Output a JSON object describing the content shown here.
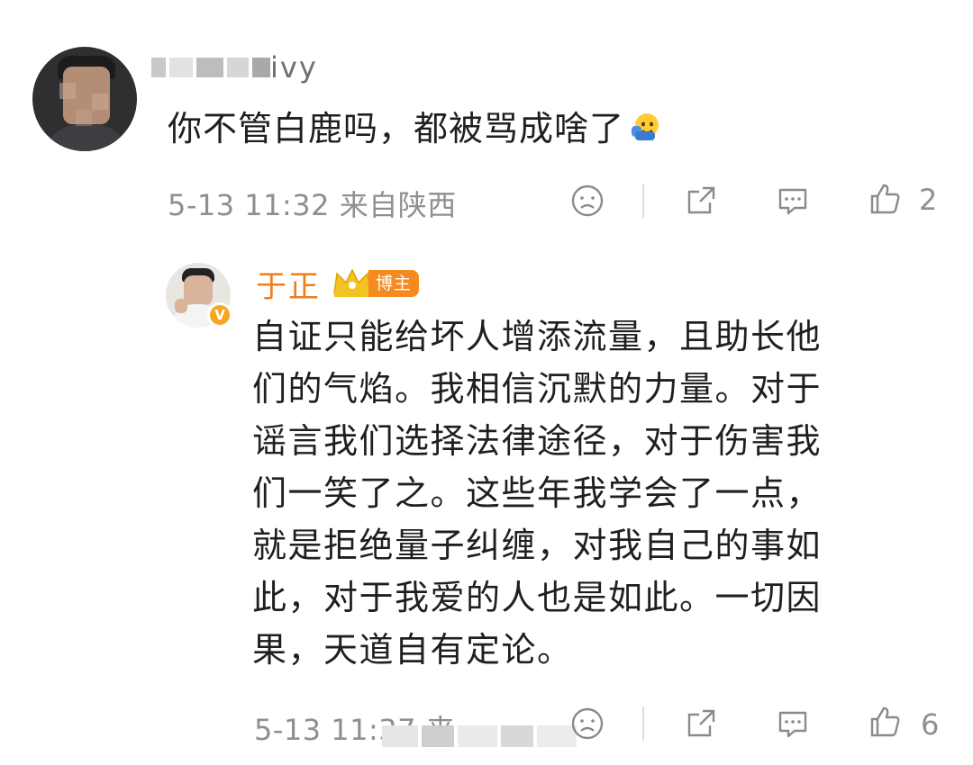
{
  "comment": {
    "username_visible": "ivy",
    "text": "你不管白鹿吗，都被骂成啥了",
    "emoji": "facepalm-emoji",
    "meta": "5-13 11:32 来自陕西",
    "likes": "2"
  },
  "reply": {
    "author": "于正",
    "author_badge": "博主",
    "author_color": "#f07d1c",
    "badge_color": "#f58a1f",
    "verified_badge": "V",
    "lines": [
      "自证只能给坏人增添流量，且助长他",
      "们的气焰。我相信沉默的力量。对于",
      "谣言我们选择法律途径，对于伤害我",
      "们一笑了之。这些年我学会了一点，",
      "就是拒绝量子纠缠，对我自己的事如",
      "此，对于我爱的人也是如此。一切因",
      "果，天道自有定论。"
    ],
    "meta": "5-13 11:37 来",
    "likes": "6"
  },
  "icons": {
    "dislike": "frown-face-icon",
    "share": "share-icon",
    "reply": "comment-bubble-icon",
    "like": "thumbs-up-icon"
  },
  "colors": {
    "meta_text": "#8f8f8f",
    "icon_stroke": "#8a8a8a"
  }
}
